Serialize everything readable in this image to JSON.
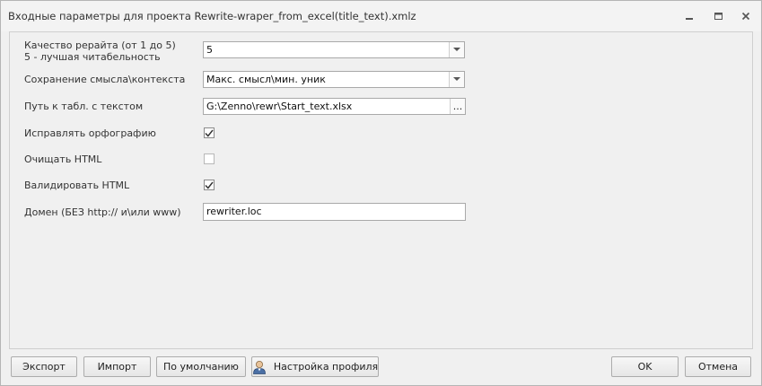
{
  "window": {
    "title": "Входные параметры для проекта Rewrite-wraper_from_excel(title_text).xmlz",
    "controls": [
      "minimize-icon",
      "restore-icon",
      "close-icon"
    ]
  },
  "form": {
    "quality": {
      "label_line1": "Качество рерайта (от 1 до 5)",
      "label_line2": "5 - лучшая читабельность",
      "value": "5"
    },
    "meaning": {
      "label": "Сохранение смысла\\контекста",
      "value": "Макс. смысл\\мин. уник"
    },
    "path": {
      "label": "Путь к табл. с текстом",
      "value": "G:\\Zenno\\rewr\\Start_text.xlsx",
      "browse": "..."
    },
    "spelling": {
      "label": "Исправлять орфографию",
      "checked": true
    },
    "clean_html": {
      "label": "Очищать HTML",
      "checked": false
    },
    "validate_html": {
      "label": "Валидировать HTML",
      "checked": true
    },
    "domain": {
      "label": "Домен (БЕЗ http:// и\\или www)",
      "value": "rewriter.loc"
    }
  },
  "buttons": {
    "export": "Экспорт",
    "import": "Импорт",
    "default": "По умолчанию",
    "profile": "Настройка профиля",
    "ok": "OK",
    "cancel": "Отмена"
  }
}
